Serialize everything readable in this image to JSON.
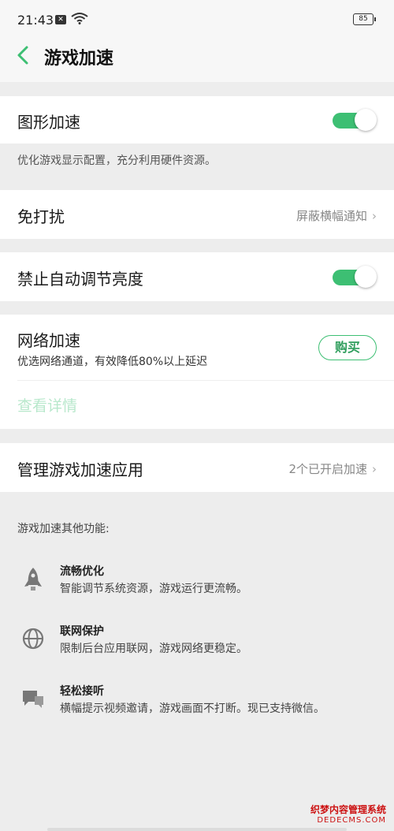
{
  "status_bar": {
    "time": "21:43",
    "notif_badge": "✕",
    "battery": "85"
  },
  "header": {
    "title": "游戏加速"
  },
  "graphics": {
    "label": "图形加速",
    "enabled": true,
    "desc": "优化游戏显示配置，充分利用硬件资源。"
  },
  "dnd": {
    "label": "免打扰",
    "value": "屏蔽横幅通知",
    "chevron": "›"
  },
  "brightness": {
    "label": "禁止自动调节亮度",
    "enabled": true
  },
  "network": {
    "label": "网络加速",
    "subtext": "优选网络通道，有效降低80%以上延迟",
    "buy_label": "购买",
    "details_label": "查看详情"
  },
  "manage": {
    "label": "管理游戏加速应用",
    "value": "2个已开启加速",
    "chevron": "›"
  },
  "others": {
    "title": "游戏加速其他功能:",
    "items": [
      {
        "icon": "rocket-icon",
        "name": "流畅优化",
        "desc": "智能调节系统资源，游戏运行更流畅。"
      },
      {
        "icon": "globe-icon",
        "name": "联网保护",
        "desc": "限制后台应用联网，游戏网络更稳定。"
      },
      {
        "icon": "chat-bubble-icon",
        "name": "轻松接听",
        "desc": "横幅提示视频邀请，游戏画面不打断。现已支持微信。"
      }
    ]
  },
  "watermark": {
    "line1": "织梦内容管理系统",
    "line2": "DEDECMS.COM"
  },
  "colors": {
    "accent": "#3dbf73",
    "background": "#ededed"
  }
}
